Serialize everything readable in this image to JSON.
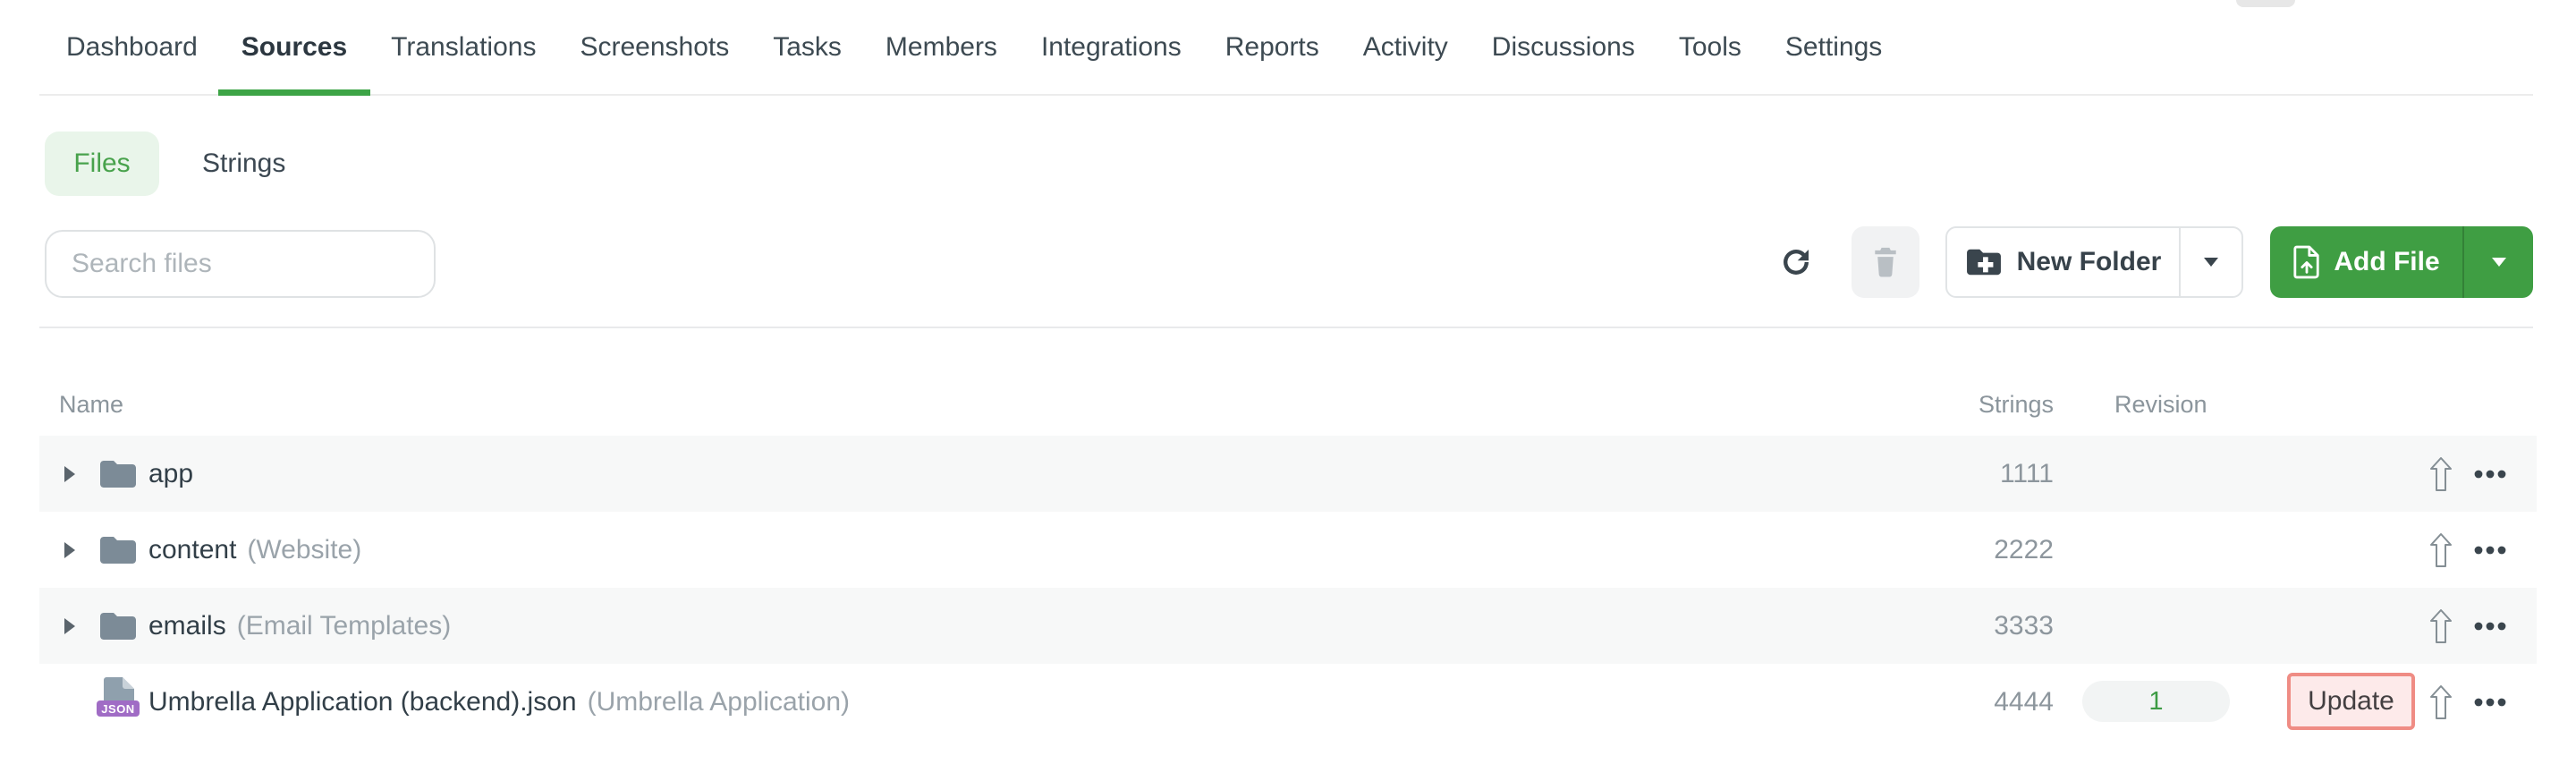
{
  "colors": {
    "accent_green": "#3f9e43",
    "green_light_bg": "#e9f5ea",
    "green_text": "#48a24c",
    "tab_underline": "#3da446",
    "nav_text": "#3d4a52",
    "nav_active_text": "#2c3740",
    "row_alt_bg": "#f7f8f8",
    "name_text": "#323f48",
    "secondary_text": "#9aa3aa",
    "values_text": "#8d969d",
    "header_text": "#8b959c",
    "border": "#e5e7e9",
    "update_border": "#ef8c84",
    "update_bg": "#fdeaea",
    "json_badge_bg": "#a06cc5",
    "folder_icon": "#7c8b97",
    "doc_icon": "#8fa0ad"
  },
  "nav": {
    "active": "Sources",
    "items": [
      {
        "label": "Dashboard"
      },
      {
        "label": "Sources"
      },
      {
        "label": "Translations"
      },
      {
        "label": "Screenshots"
      },
      {
        "label": "Tasks"
      },
      {
        "label": "Members"
      },
      {
        "label": "Integrations"
      },
      {
        "label": "Reports"
      },
      {
        "label": "Activity"
      },
      {
        "label": "Discussions"
      },
      {
        "label": "Tools"
      },
      {
        "label": "Settings"
      }
    ]
  },
  "view_toggle": {
    "files_label": "Files",
    "strings_label": "Strings",
    "selected": "Files"
  },
  "toolbar": {
    "search_placeholder": "Search files",
    "new_folder_label": "New Folder",
    "add_file_label": "Add File"
  },
  "icons": {
    "refresh": "circular-arrow",
    "trash": "trash-can",
    "new_folder": "folder-plus",
    "add_file": "document-arrow-up",
    "dropdown_caret": "caret-down",
    "expand_caret": "caret-right",
    "folder": "folder",
    "json_file": "document-with-json-badge",
    "upload": "hollow-up-arrow",
    "more": "three-dots"
  },
  "table": {
    "headers": {
      "name": "Name",
      "strings": "Strings",
      "revision": "Revision"
    },
    "rows": [
      {
        "type": "folder",
        "name": "app",
        "note": "",
        "strings": "1111",
        "revision": ""
      },
      {
        "type": "folder",
        "name": "content",
        "note": "(Website)",
        "strings": "2222",
        "revision": ""
      },
      {
        "type": "folder",
        "name": "emails",
        "note": "(Email Templates)",
        "strings": "3333",
        "revision": ""
      },
      {
        "type": "file",
        "name": "Umbrella Application (backend).json",
        "note": "(Umbrella Application)",
        "strings": "4444",
        "revision": "1",
        "badge": "JSON",
        "update_label": "Update"
      }
    ]
  }
}
